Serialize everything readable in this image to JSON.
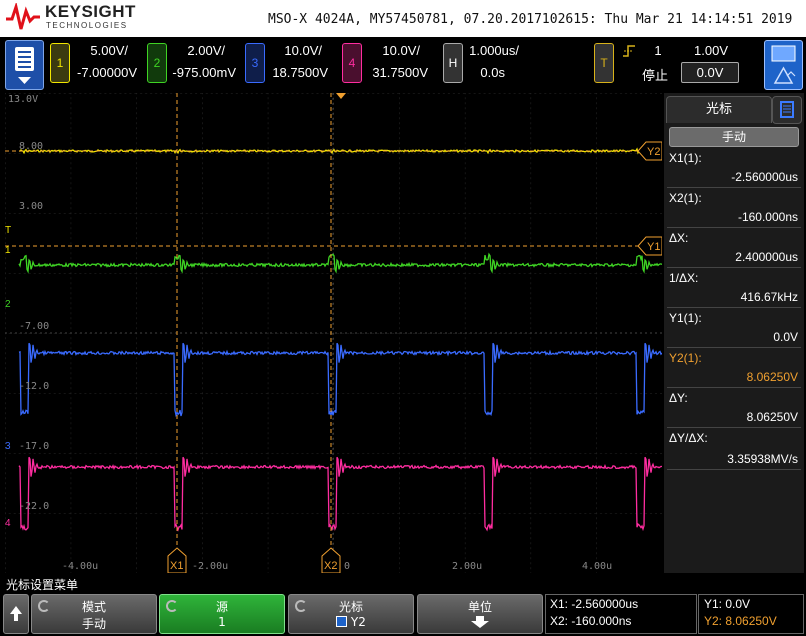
{
  "header": {
    "brand": "KEYSIGHT",
    "brand_sub": "TECHNOLOGIES",
    "model_line": "MSO-X 4024A, MY57450781, 07.20.2017102615: Thu Mar 21 14:14:51 2019"
  },
  "channels": [
    {
      "num": "1",
      "scale": "5.00V/",
      "offset": "-7.00000V",
      "color": "#f2e600"
    },
    {
      "num": "2",
      "scale": "2.00V/",
      "offset": "-975.00mV",
      "color": "#3fd424"
    },
    {
      "num": "3",
      "scale": "10.0V/",
      "offset": "18.7500V",
      "color": "#3a6bff"
    },
    {
      "num": "4",
      "scale": "10.0V/",
      "offset": "31.7500V",
      "color": "#ff2da0"
    }
  ],
  "horizontal": {
    "label": "H",
    "scale": "1.000us/",
    "delay": "0.0s"
  },
  "trigger": {
    "label": "T",
    "channel": "1",
    "level": "1.00V",
    "status": "停止",
    "level_box": "0.0V"
  },
  "waveform": {
    "ref_labels": [
      "13.0V",
      "8.00",
      "3.00",
      "-7.00",
      "-12.0",
      "-17.0",
      "-22.0"
    ],
    "time_labels": [
      "-4.00u",
      "-2.00u",
      "0",
      "2.00u",
      "4.00u"
    ],
    "cursor_tags": {
      "x1": "X1",
      "x2": "X2",
      "y1": "Y1",
      "y2": "Y2"
    },
    "marker_labels": {
      "t": "T",
      "ch1": "1",
      "ch2": "2",
      "ch3": "3",
      "ch4": "4"
    }
  },
  "cursor_panel": {
    "tab": "光标",
    "mode": "手动",
    "rows": [
      {
        "label": "X1(1):",
        "value": "-2.560000us"
      },
      {
        "label": "X2(1):",
        "value": "-160.000ns"
      },
      {
        "label": "ΔX:",
        "value": "2.400000us"
      },
      {
        "label": "1/ΔX:",
        "value": "416.67kHz"
      },
      {
        "label": "Y1(1):",
        "value": "0.0V"
      },
      {
        "label": "Y2(1):",
        "value": "8.06250V"
      },
      {
        "label": "ΔY:",
        "value": "8.06250V"
      },
      {
        "label": "ΔY/ΔX:",
        "value": "3.35938MV/s"
      }
    ],
    "highlight_color": "#f0a030"
  },
  "softkeys": {
    "menu_title": "光标设置菜单",
    "keys": [
      {
        "top": "模式",
        "bottom": "手动"
      },
      {
        "top": "源",
        "bottom": "1"
      },
      {
        "top": "光标",
        "bottom": "Y2"
      },
      {
        "top": "单位",
        "bottom": ""
      }
    ]
  },
  "readout": {
    "x1": "X1: -2.560000us",
    "x2": "X2: -160.000ns",
    "y1": "Y1: 0.0V",
    "y2": "Y2: 8.06250V"
  }
}
